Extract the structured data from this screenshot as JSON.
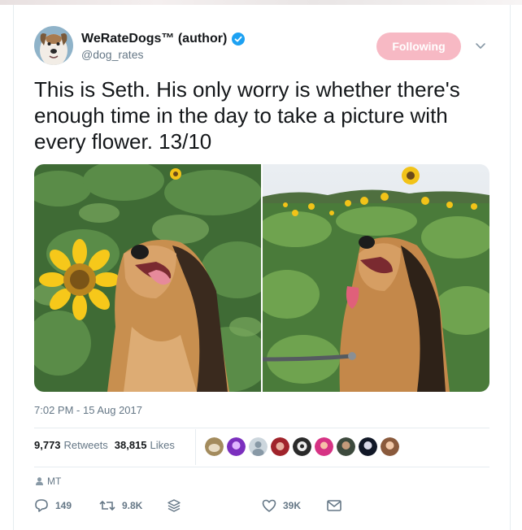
{
  "tweet": {
    "author": {
      "display_name": "WeRateDogs™ (author)",
      "handle": "@dog_rates",
      "verified": true
    },
    "follow_button_label": "Following",
    "follow_button_color": "#f7b9c4",
    "text": "This is Seth. His only worry is whether there's enough time in the day to take a picture with every flower. 13/10",
    "media_icons": [
      "photo-dog-sunflower-left",
      "photo-dog-sunflower-right"
    ],
    "timestamp": "7:02 PM - 15 Aug 2017",
    "stats": {
      "retweets_count": "9,773",
      "retweets_label": "Retweets",
      "likes_count": "38,815",
      "likes_label": "Likes"
    },
    "liker_avatar_count": 9,
    "reply_to": "MT",
    "actions": {
      "reply_count": "149",
      "retweet_count": "9.8K",
      "like_count": "39K"
    }
  },
  "colors": {
    "text_primary": "#14171a",
    "text_secondary": "#657786",
    "verified_blue": "#1da1f2",
    "divider": "#e6ecf0"
  }
}
